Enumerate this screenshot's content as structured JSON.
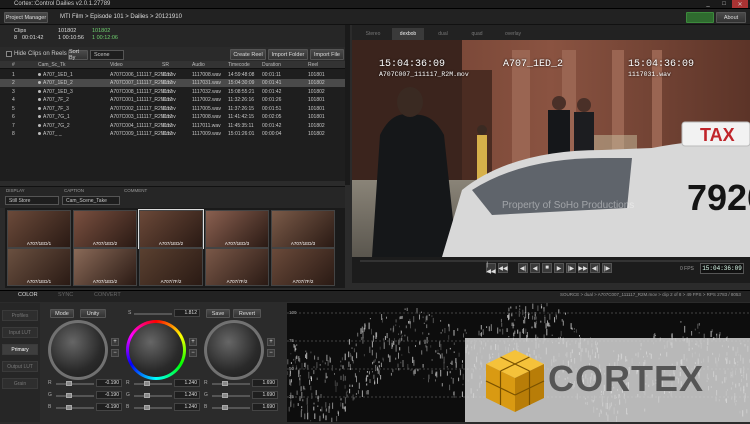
{
  "window": {
    "title": "Cortex::Control Dailies v2.0.1.27789",
    "min": "_",
    "max": "□",
    "close": "✕"
  },
  "topbar": {
    "project_manager": "Project Manager",
    "breadcrumb": "MTI Film > Episode 101 > Dailies > 20121910",
    "green_button": "",
    "about": "About"
  },
  "stats": {
    "clips_label": "Clips",
    "clips_count": "8",
    "clips_duration": "00:01:42",
    "col2_a": "101802",
    "col2_b": "1  00:10:56",
    "col3_a": "101802",
    "col3_b": "1  00:12:06"
  },
  "toolbar": {
    "hide_clips_label": "Hide Clips on Reels",
    "sort_by_label": "Sort By",
    "sort_by_value": "Scene",
    "create_reel": "Create Reel",
    "import_folder": "Import Folder",
    "import_file": "Import File"
  },
  "table": {
    "headers": [
      "#",
      "Cam_Sc_Tk",
      "Video",
      "SR",
      "Audio",
      "Timecode",
      "Duration",
      "Reel"
    ],
    "rows": [
      [
        "1",
        "A707_1ED_1",
        "A707C006_111117_R2M.mov",
        "1117",
        "1117008.wav",
        "14:59:48:08",
        "00:01:11",
        "101801"
      ],
      [
        "2",
        "A707_1ED_2",
        "A707C007_111117_R2M.mov",
        "1117",
        "1117031.wav",
        "15:04:30:09",
        "00:01:41",
        "101802"
      ],
      [
        "3",
        "A707_1ED_3",
        "A707C008_111117_R2M.mov",
        "1117",
        "1117032.wav",
        "15:08:55:21",
        "00:01:42",
        "101802"
      ],
      [
        "4",
        "A707_7F_2",
        "A707C001_111117_R2M.mov",
        "1117",
        "1117002.wav",
        "11:32:26:16",
        "00:01:26",
        "101801"
      ],
      [
        "5",
        "A707_7F_3",
        "A707C002_111117_R2M.mov",
        "1117",
        "1117005.wav",
        "11:37:26:15",
        "00:01:51",
        "101801"
      ],
      [
        "6",
        "A707_7G_1",
        "A707C003_111117_R2M.mov",
        "1117",
        "1117008.wav",
        "11:41:42:15",
        "00:02:05",
        "101801"
      ],
      [
        "7",
        "A707_7G_2",
        "A707C004_111117_R2M.mov",
        "1117",
        "1117011.wav",
        "11:45:35:11",
        "00:01:42",
        "101802"
      ],
      [
        "8",
        "A707_ _",
        "A707C009_111117_R2M.mov",
        "1117",
        "1117009.wav",
        "15:01:26:01",
        "00:00:04",
        "101802"
      ]
    ]
  },
  "display": {
    "display_label": "DISPLAY",
    "caption_label": "CAPTION",
    "comment_label": "COMMENT",
    "display_value": "Still Store",
    "caption_value": "Cam_Scene_Take"
  },
  "thumbs": [
    "A707/1ED/1",
    "A707/1ED/2",
    "A707/1ED/2",
    "A707/1ED/3",
    "A707/1ED/3",
    "A707/1ED/1",
    "A707/1ED/2",
    "A707/7F/2",
    "A707/7F/2",
    "A707/7F/2"
  ],
  "viewer": {
    "tabs": [
      "Stereo",
      "dexbob",
      "dual",
      "quad",
      "overlay"
    ],
    "active_tab": "dexbob",
    "tc_left": "15:04:36:09",
    "file_left": "A707C007_111117_R2M.mov",
    "clip_name": "A707_1ED_2",
    "tc_right": "15:04:36:09",
    "file_right": "1117031.wav",
    "watermark": "Property of SoHo Productions",
    "taxi_sign": "TAX",
    "taxi_number": "7926"
  },
  "transport": {
    "fps": "0 FPS",
    "timecode": "15:04:36:09",
    "buttons": [
      "|◀◀",
      "◀◀",
      "◀|",
      "◀",
      "■",
      "▶",
      "|▶",
      "▶▶",
      "◀|",
      "|▶"
    ]
  },
  "bottom": {
    "tabs": [
      "COLOR",
      "SYNC",
      "CONVERT"
    ],
    "active_tab": "COLOR",
    "info": "SOURCE > dual > A707C007_111117_R2M.mov > clip 2 of 8 > 49 FPS > RPS 2783 / 8053"
  },
  "side_menu": [
    "Profiles",
    "Input LUT",
    "Primary",
    "Output LUT",
    "Grain"
  ],
  "side_active": "Primary",
  "color": {
    "mode": "Mode",
    "unity": "Unity",
    "s_label": "S",
    "sat_value": "1.812",
    "save": "Save",
    "revert": "Revert",
    "wheels": [
      {
        "values": [
          "-0.190",
          "-0.190",
          "-0.190"
        ]
      },
      {
        "values": [
          "1.240",
          "1.240",
          "1.240"
        ]
      },
      {
        "values": [
          "1.690",
          "1.690",
          "1.690"
        ]
      }
    ],
    "channels": [
      "R",
      "G",
      "B"
    ],
    "plus": "+",
    "minus": "−"
  },
  "scope": {
    "ticks": [
      "100",
      "75",
      "50",
      "25"
    ]
  },
  "logo": {
    "text": "CORTEX"
  }
}
